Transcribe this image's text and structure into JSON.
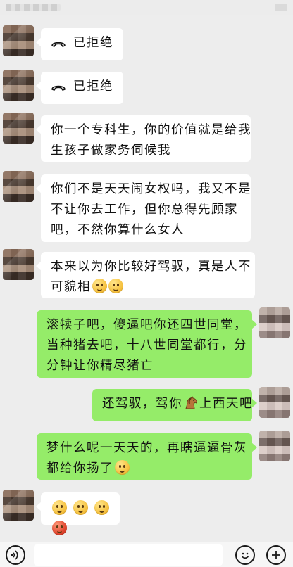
{
  "status_bar": {
    "carrier_blurred": true
  },
  "messages": [
    {
      "side": "left",
      "type": "call",
      "text": "已拒绝",
      "icon": "declined-call-icon"
    },
    {
      "side": "left",
      "type": "call",
      "text": "已拒绝",
      "icon": "declined-call-icon"
    },
    {
      "side": "left",
      "type": "text",
      "lines": [
        "你一个专科生，你的价值就是给我",
        "生孩子做家务伺候我"
      ]
    },
    {
      "side": "left",
      "type": "text",
      "lines": [
        "你们不是天天闹女权吗，我又不是",
        "不让你去工作，但你总得先顾家",
        "吧，不然你算什么女人"
      ]
    },
    {
      "side": "left",
      "type": "text",
      "lines": [
        "本来以为你比较好驾驭，真是人不",
        "可貌相"
      ],
      "emojis": [
        "pleading-face-icon",
        "pleading-face-icon"
      ]
    },
    {
      "side": "right",
      "type": "text",
      "lines": [
        "滚犊子吧，傻逼吧你还四世同堂，",
        "当种猪去吧，十八世同堂都行，分",
        "分钟让你精尽猪亡"
      ]
    },
    {
      "side": "right",
      "type": "text",
      "lines": [
        "还驾驭，驾你",
        "上西天吧"
      ],
      "emojis": [
        "horse-icon"
      ]
    },
    {
      "side": "right",
      "type": "text",
      "lines": [
        "梦什么呢一天天的，再瞎逼逼骨灰",
        "都给你扬了"
      ],
      "emojis": [
        "smile-icon"
      ]
    },
    {
      "side": "left",
      "type": "emoji",
      "emojis": [
        "pleading-face-icon",
        "pleading-face-icon",
        "pleading-face-icon",
        "angry-face-icon"
      ]
    }
  ],
  "colors": {
    "chat_bg": "#ededed",
    "left_bubble": "#ffffff",
    "right_bubble": "#95ec69"
  },
  "input_bar": {
    "voice_icon": "voice-icon",
    "emoji_icon": "emoji-icon",
    "plus_icon": "plus-icon"
  }
}
